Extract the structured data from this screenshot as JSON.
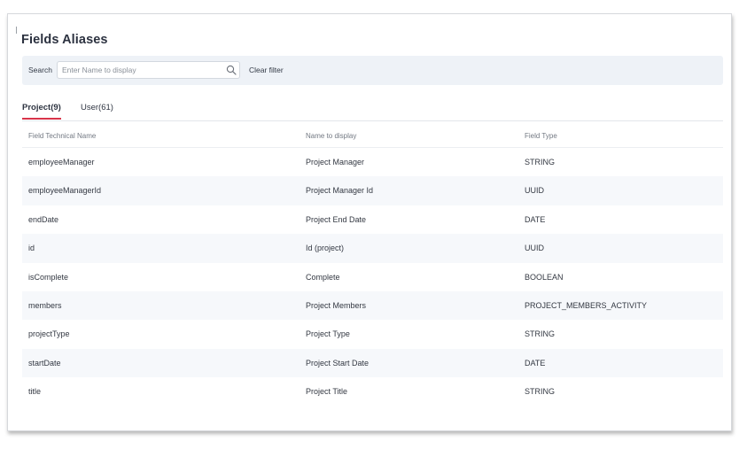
{
  "page": {
    "title": "Fields Aliases"
  },
  "search": {
    "label": "Search",
    "placeholder": "Enter Name to display",
    "value": "",
    "clear_label": "Clear filter"
  },
  "tabs": [
    {
      "label": "Project(9)",
      "active": true
    },
    {
      "label": "User(61)",
      "active": false
    }
  ],
  "table": {
    "columns": [
      "Field Technical Name",
      "Name to display",
      "Field Type"
    ],
    "rows": [
      [
        "employeeManager",
        "Project Manager",
        "STRING"
      ],
      [
        "employeeManagerId",
        "Project Manager Id",
        "UUID"
      ],
      [
        "endDate",
        "Project End Date",
        "DATE"
      ],
      [
        "id",
        "Id (project)",
        "UUID"
      ],
      [
        "isComplete",
        "Complete",
        "BOOLEAN"
      ],
      [
        "members",
        "Project Members",
        "PROJECT_MEMBERS_ACTIVITY"
      ],
      [
        "projectType",
        "Project Type",
        "STRING"
      ],
      [
        "startDate",
        "Project Start Date",
        "DATE"
      ],
      [
        "title",
        "Project Title",
        "STRING"
      ]
    ]
  },
  "colors": {
    "accent": "#d9344a",
    "search_bar_bg": "#eef2f7",
    "stripe_bg": "#f6f8fb"
  },
  "icons": {
    "search": "search-icon"
  }
}
